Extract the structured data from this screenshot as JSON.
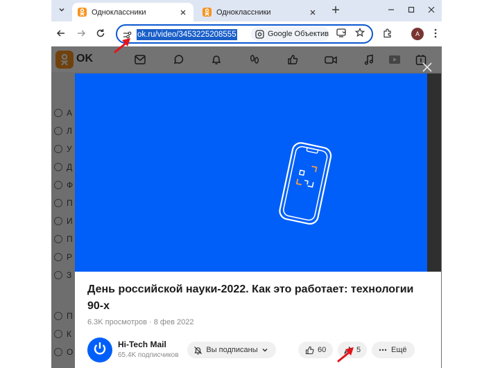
{
  "browser": {
    "tabs": [
      {
        "title": "Одноклассники",
        "active": true
      },
      {
        "title": "Одноклассники",
        "active": false
      }
    ],
    "url": "ok.ru/video/3453225208555",
    "lens_label": "Google Объектив",
    "profile_initial": "A"
  },
  "site": {
    "brand": "OK",
    "sidebar_letters": [
      "А",
      "Л",
      "У",
      "Д",
      "Ф",
      "П",
      "И",
      "П",
      "Р",
      "З",
      "П",
      "К",
      "О"
    ]
  },
  "video": {
    "title": "День российской науки-2022. Как это работает: технологии 90-х",
    "views": "6.3K просмотров",
    "date": "8 фев 2022",
    "meta_separator": "·"
  },
  "channel": {
    "name": "Hi-Tech Mail",
    "subscribers": "65.4K подписчиков",
    "subscribed_label": "Вы подписаны"
  },
  "actions": {
    "likes": "60",
    "shares": "5",
    "more_label": "Ещё"
  },
  "colors": {
    "ok_orange": "#f7931e",
    "video_blue": "#005ff9",
    "omnibox_border": "#0b57d0",
    "annotation_red": "#e1141b"
  }
}
